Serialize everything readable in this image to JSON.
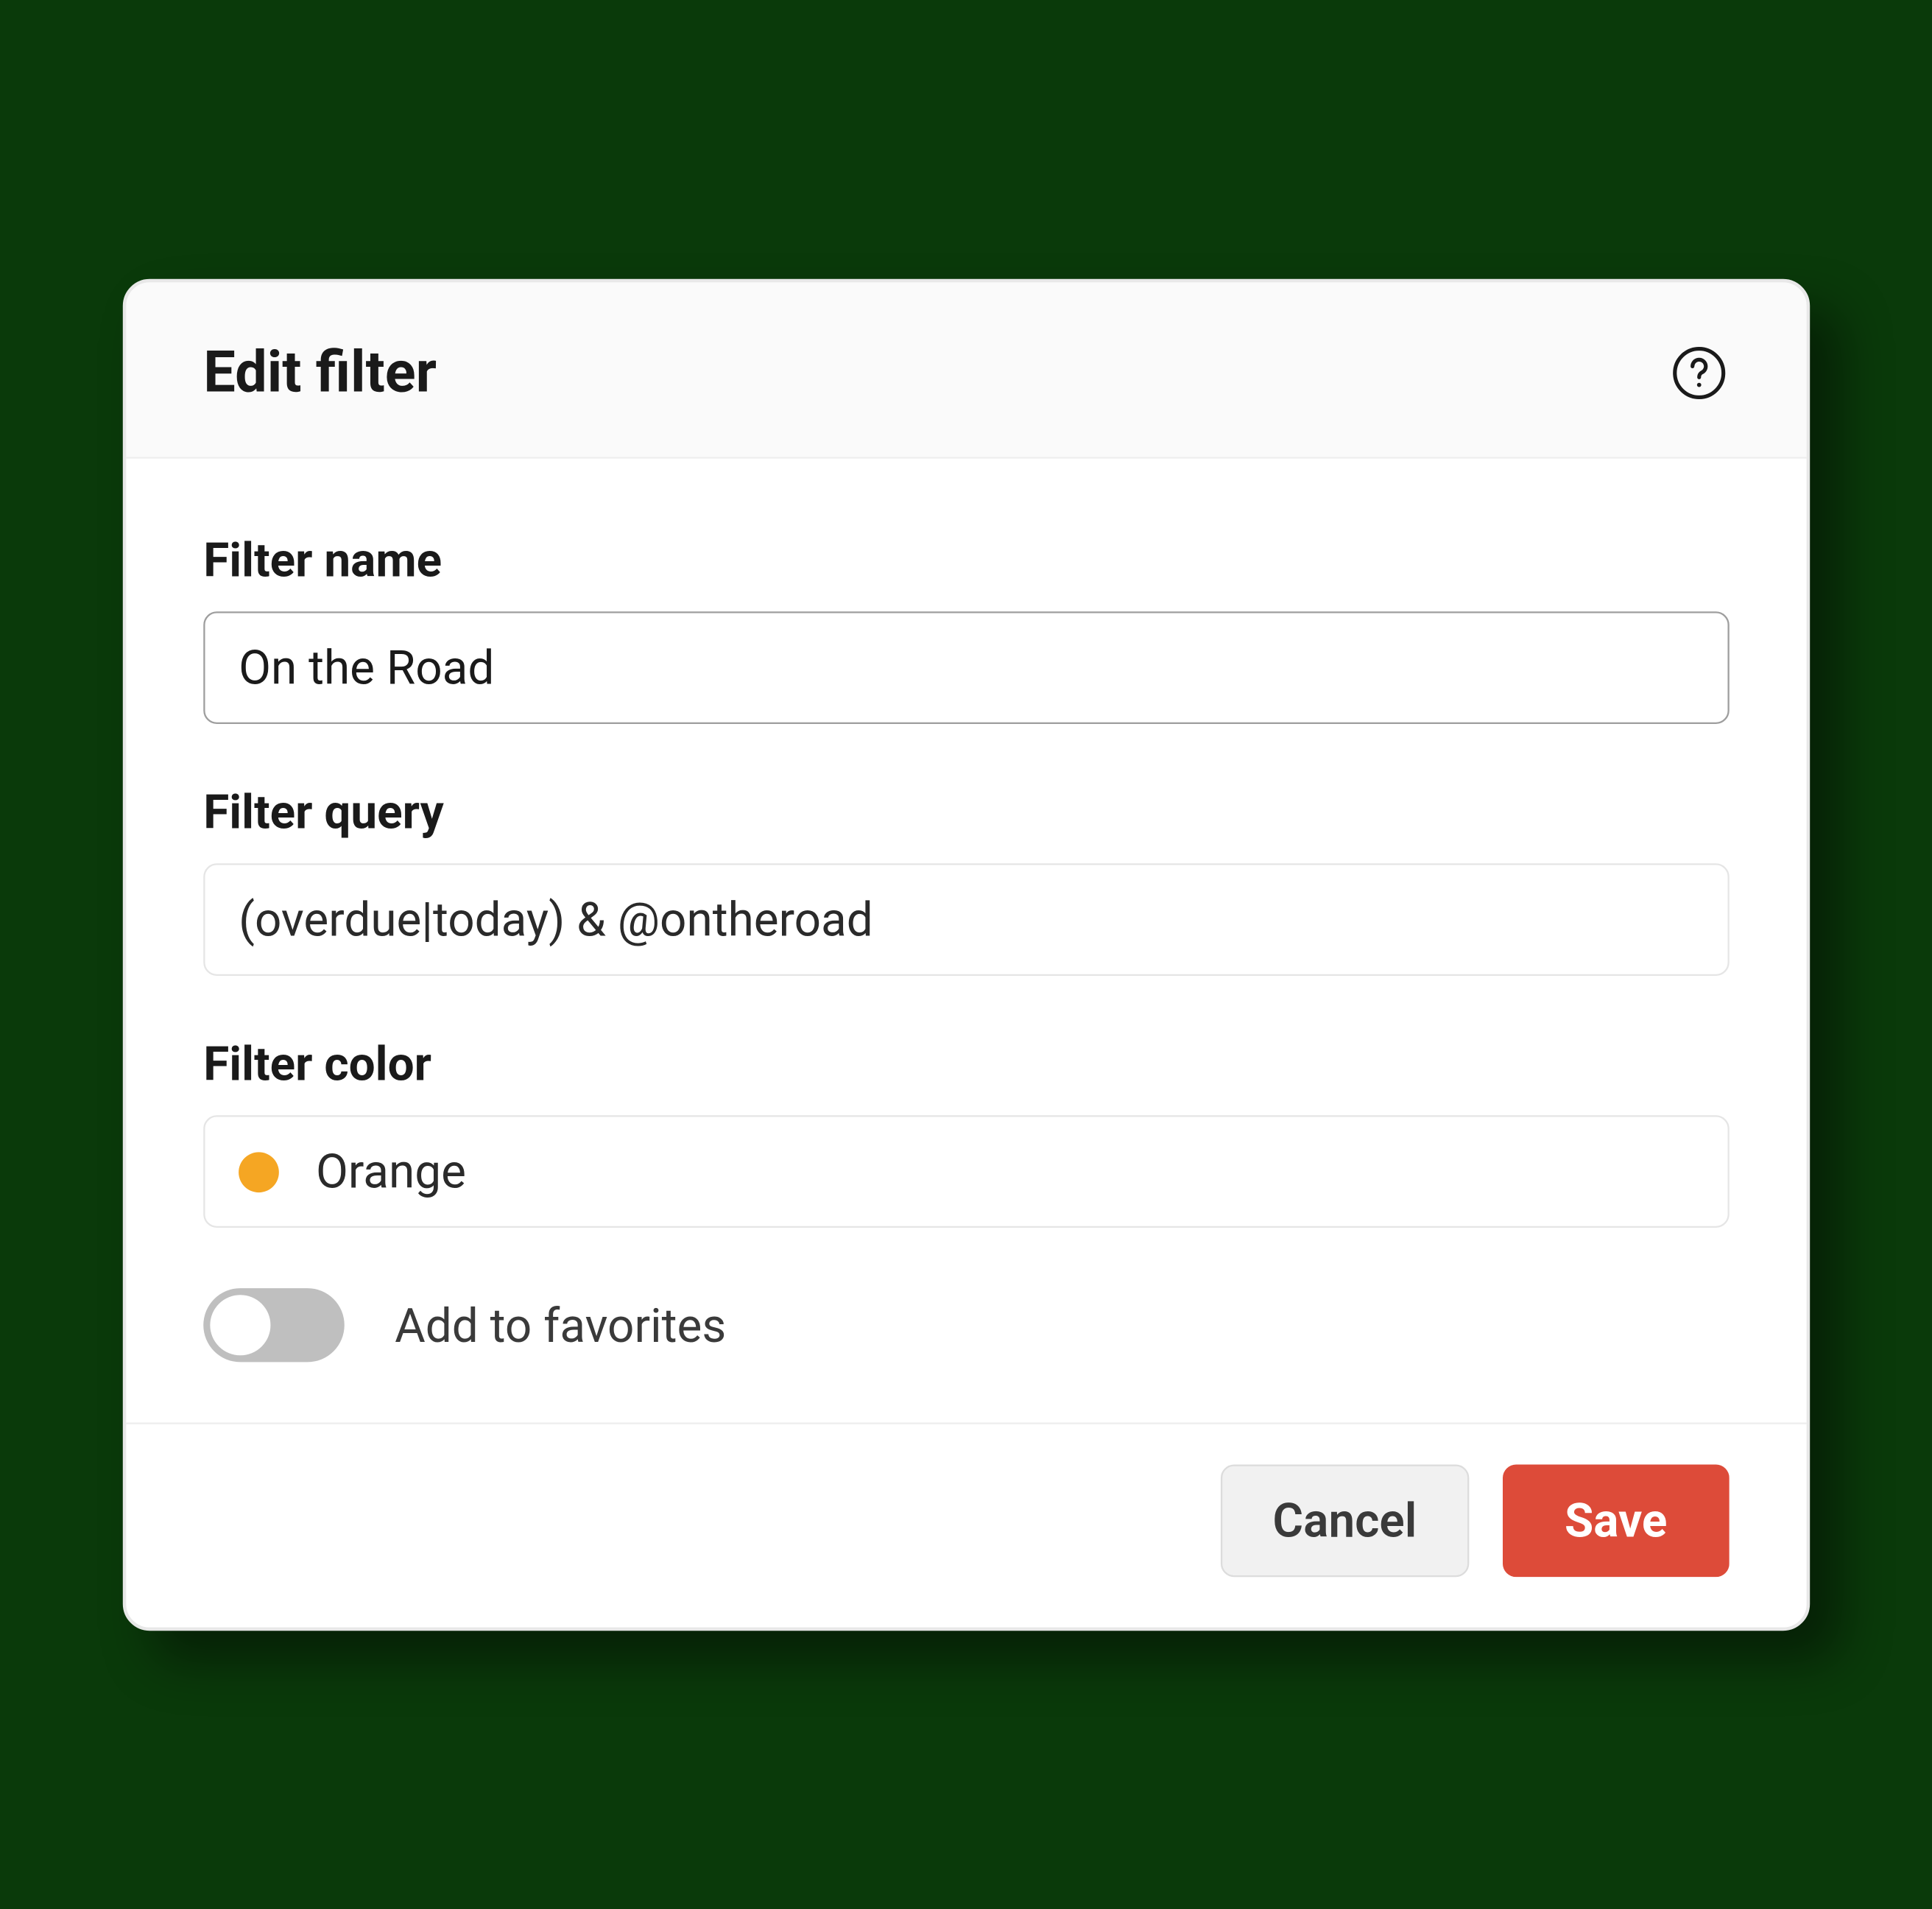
{
  "modal": {
    "title": "Edit filter",
    "fields": {
      "name": {
        "label": "Filter name",
        "value": "On the Road"
      },
      "query": {
        "label": "Filter query",
        "value": "(overdue|today) & @ontheroad"
      },
      "color": {
        "label": "Filter color",
        "selected_name": "Orange",
        "selected_hex": "#f5a623"
      },
      "favorites": {
        "label": "Add to favorites",
        "enabled": false
      }
    },
    "actions": {
      "cancel": "Cancel",
      "save": "Save"
    },
    "colors": {
      "save_button": "#dd4b39"
    }
  }
}
